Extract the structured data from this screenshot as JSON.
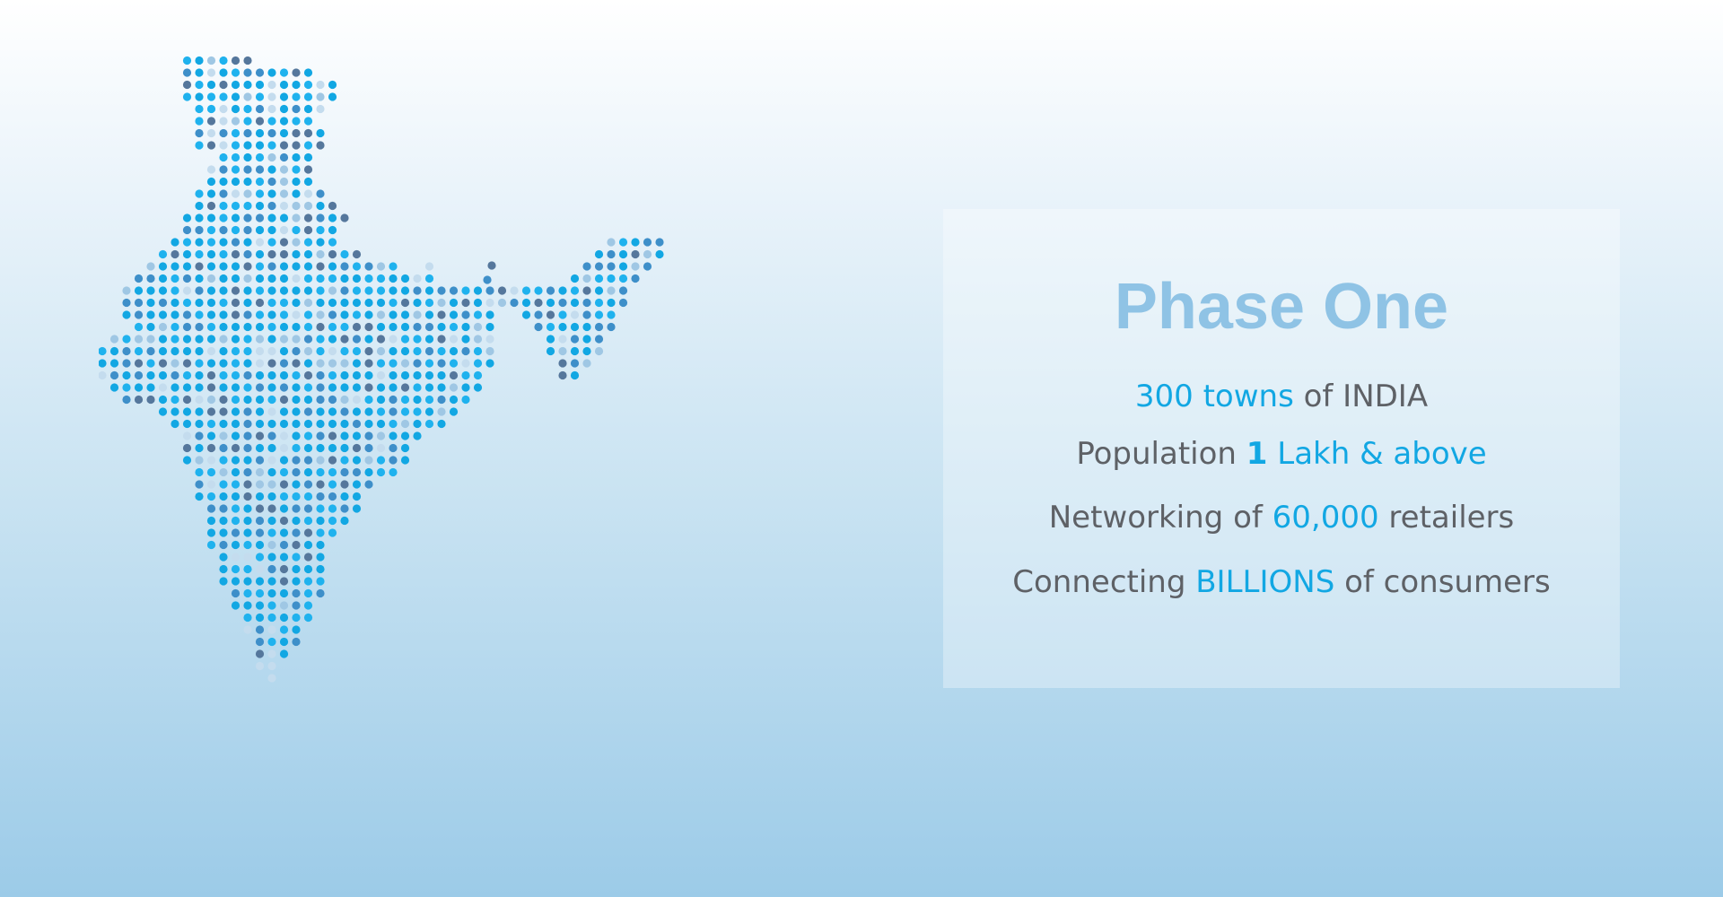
{
  "title": "Phase One",
  "lines": [
    {
      "highlight": "300 towns",
      "text": " of INDIA"
    },
    {
      "text": "Population ",
      "number": "1",
      "highlight": " Lakh & above"
    },
    {
      "text": "Networking of ",
      "highlight": "60,000",
      "text_after": " retailers"
    },
    {
      "text": "Connecting ",
      "highlight": "BILLIONS",
      "text_after": " of consumers"
    }
  ],
  "colors": {
    "title": "#8fc3e5",
    "highlight": "#12a7e3",
    "body_text": "#5e6166",
    "dot_palette": [
      "#12a7e3",
      "#1fb2ee",
      "#3e8fc9",
      "#55779c",
      "#9fc7e4",
      "#c4dcee"
    ]
  },
  "map": {
    "subject": "dotted-map-of-india"
  }
}
